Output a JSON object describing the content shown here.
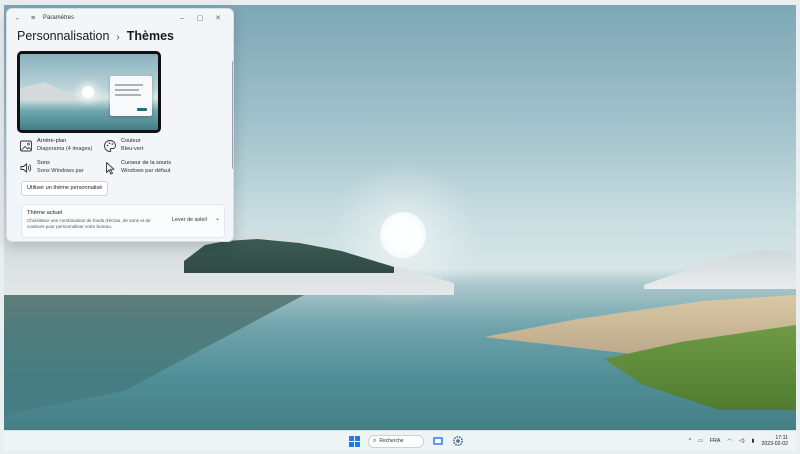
{
  "window": {
    "app_title": "Paramètres",
    "breadcrumb_parent": "Personnalisation",
    "breadcrumb_separator": "›",
    "breadcrumb_current": "Thèmes"
  },
  "tiles": {
    "background": {
      "name": "Arrière-plan",
      "value": "Diaporama (4 images)",
      "icon": "image-icon"
    },
    "color": {
      "name": "Couleur",
      "value": "Bleu-vert",
      "icon": "palette-icon"
    },
    "sounds": {
      "name": "Sons",
      "value": "Sons Windows par",
      "icon": "speaker-icon"
    },
    "cursor": {
      "name": "Curseur de la souris",
      "value": "Windows par défaut",
      "icon": "cursor-icon"
    }
  },
  "custom_theme_label": "Utiliser un thème personnalisé",
  "current_theme": {
    "title": "Thème actuel",
    "description": "Choisissez une combinaison de fonds d'écran, de sons et de couleurs pour personnaliser votre bureau.",
    "value": "Lever de soleil"
  },
  "taskbar": {
    "search_label": "Recherche",
    "language": "FRA",
    "time": "17:11",
    "date": "2023-02-02"
  },
  "colors": {
    "accent": "#1f7de0",
    "window_bg": "#f3f6f8"
  }
}
